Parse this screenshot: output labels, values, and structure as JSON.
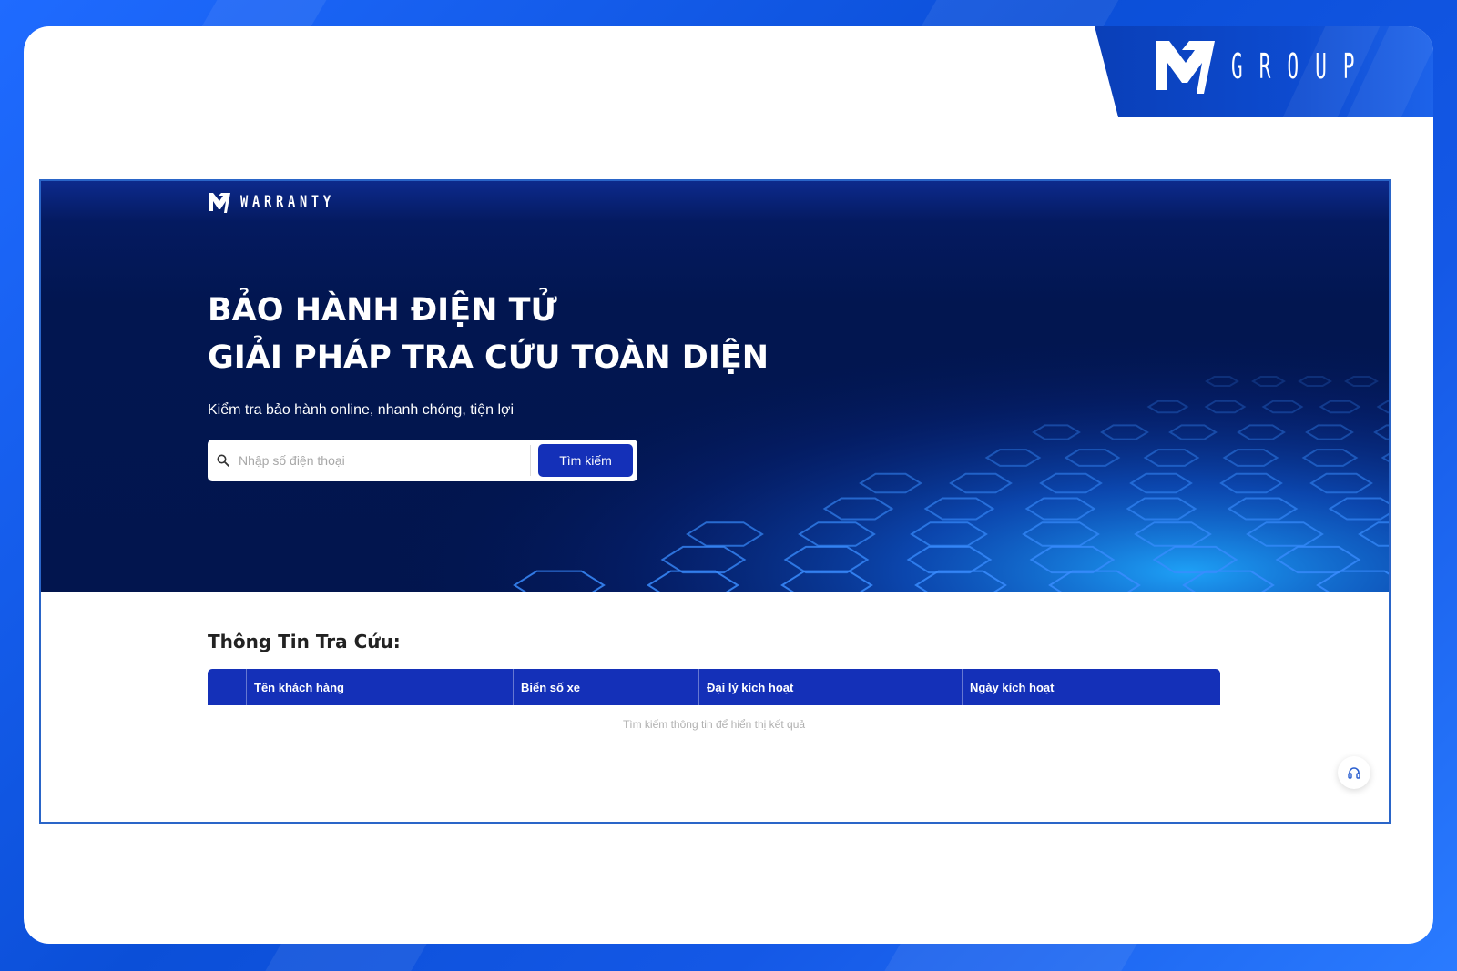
{
  "brand": {
    "name": "GROUP"
  },
  "hero": {
    "logo_text": "WARRANTY",
    "title_line1": "BẢO HÀNH ĐIỆN TỬ",
    "title_line2": "GIẢI PHÁP TRA CỨU TOÀN DIỆN",
    "subtitle": "Kiểm tra bảo hành online, nhanh chóng, tiện lợi"
  },
  "search": {
    "placeholder": "Nhập số điện thoại",
    "value": "",
    "button_label": "Tìm kiếm",
    "icon": "search-icon"
  },
  "results": {
    "title": "Thông Tin Tra Cứu:",
    "columns": [
      "",
      "Tên khách hàng",
      "Biển số xe",
      "Đại lý kích hoạt",
      "Ngày kích hoạt"
    ],
    "empty_message": "Tìm kiếm thông tin để hiển thị kết quả"
  },
  "support": {
    "icon": "headset-icon"
  },
  "colors": {
    "background_blue": "#0b4fd8",
    "hero_navy": "#02154e",
    "accent_button": "#1430b8",
    "table_header": "#1430b8"
  }
}
